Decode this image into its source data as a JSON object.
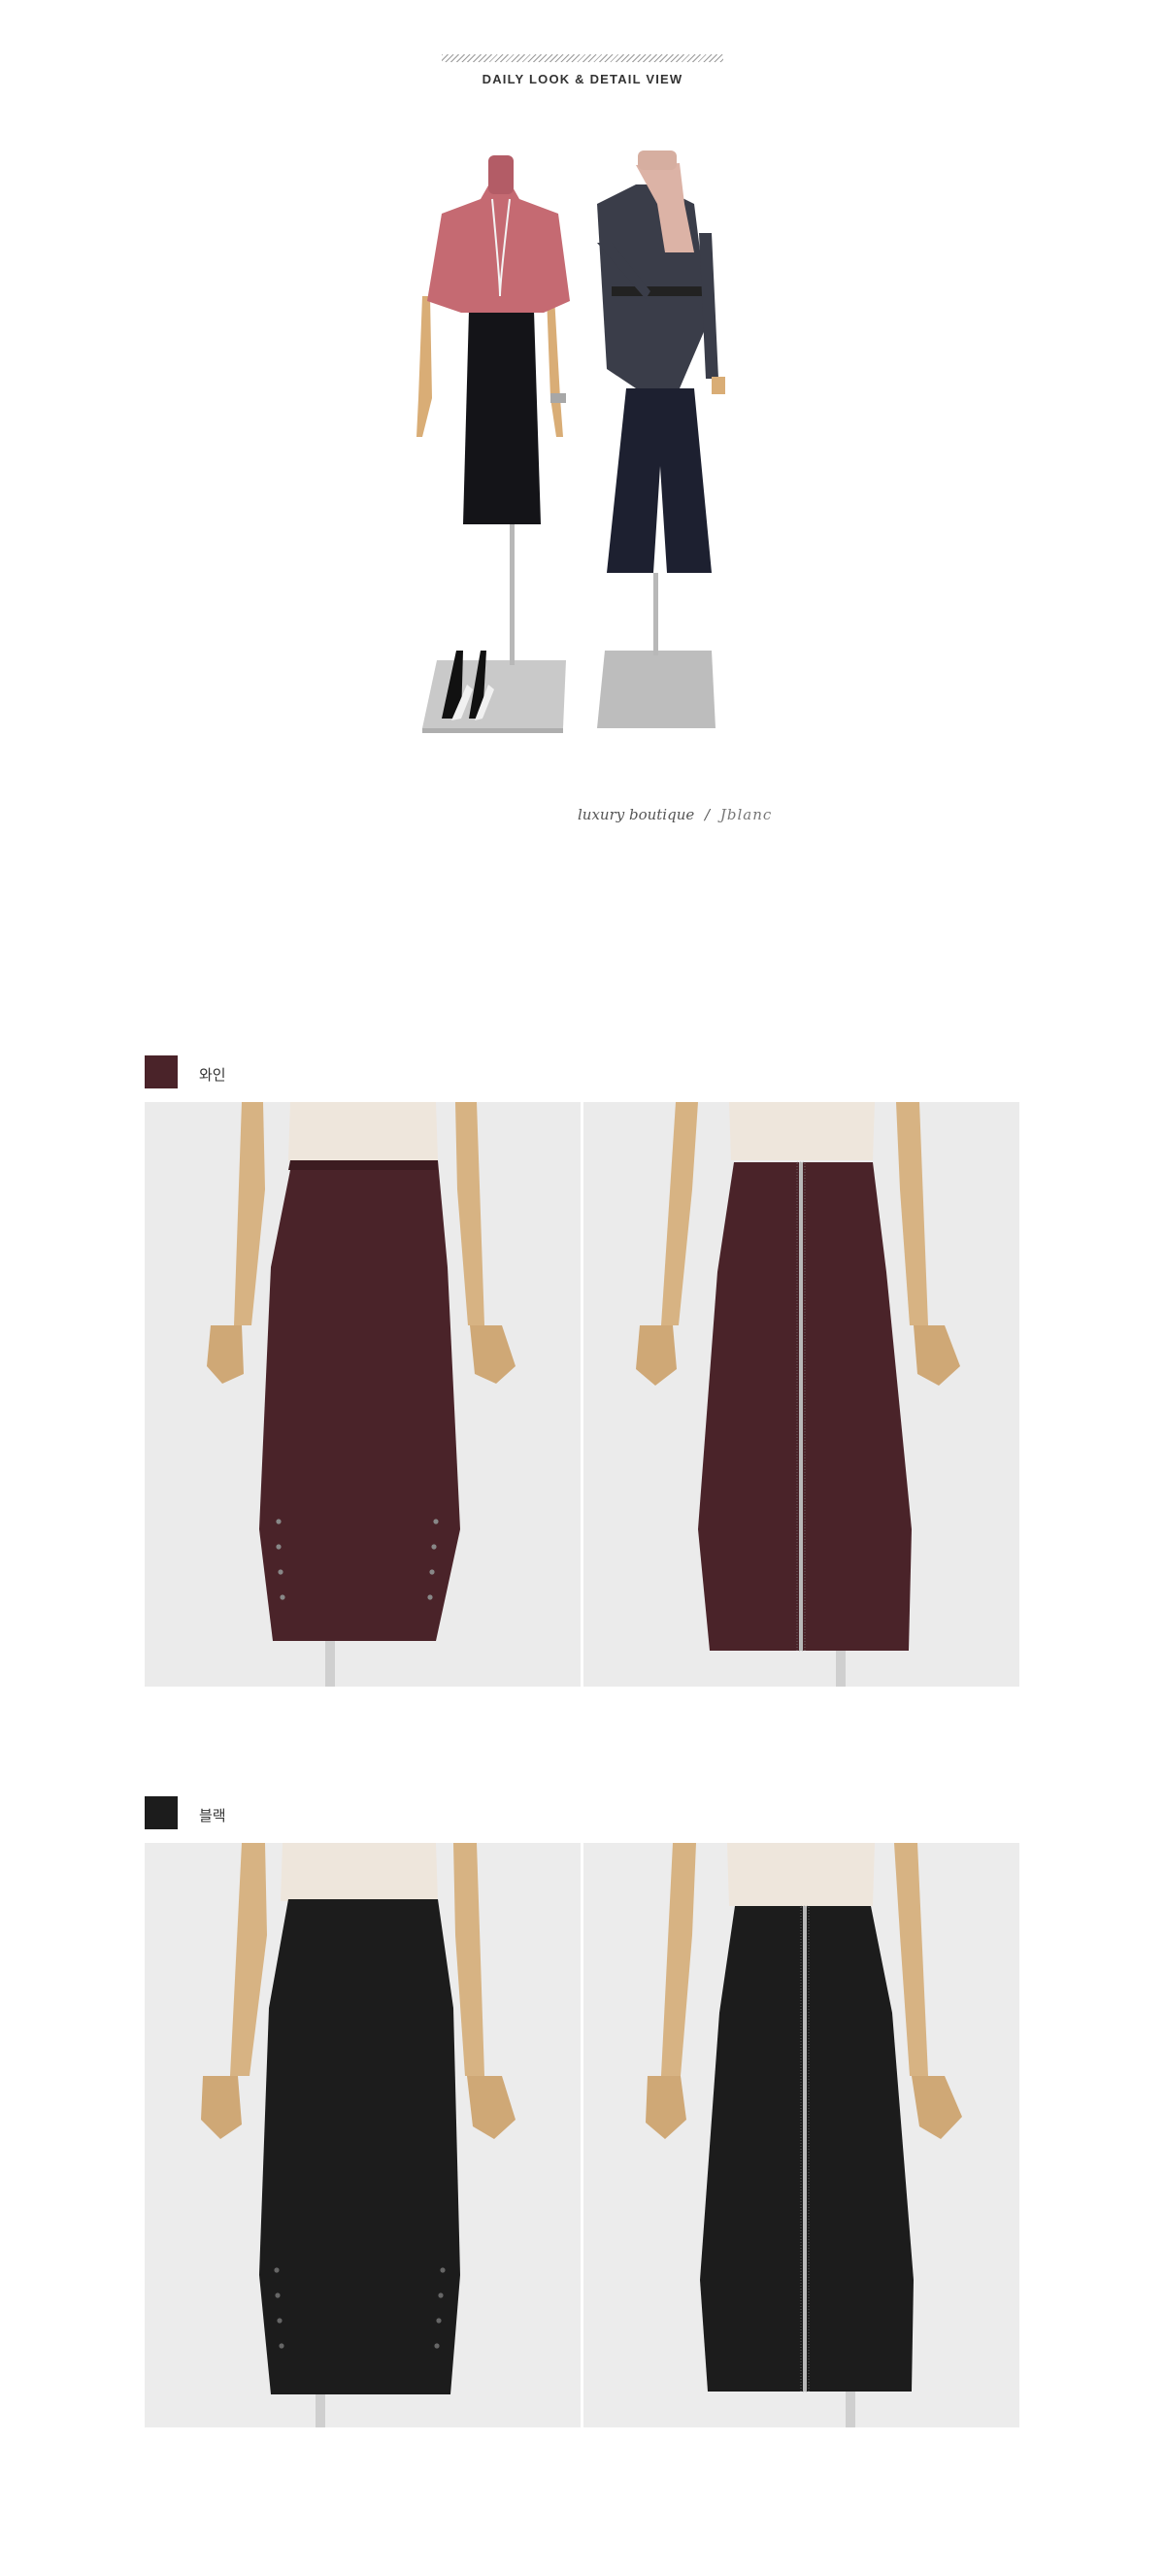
{
  "header": {
    "title": "DAILY LOOK & DETAIL VIEW"
  },
  "brand": {
    "text": "luxury boutique",
    "separator": "/",
    "signature": "Jblanc"
  },
  "colors": [
    {
      "label": "와인",
      "hex": "#4a2329"
    },
    {
      "label": "블랙",
      "hex": "#1c1c1c"
    }
  ]
}
